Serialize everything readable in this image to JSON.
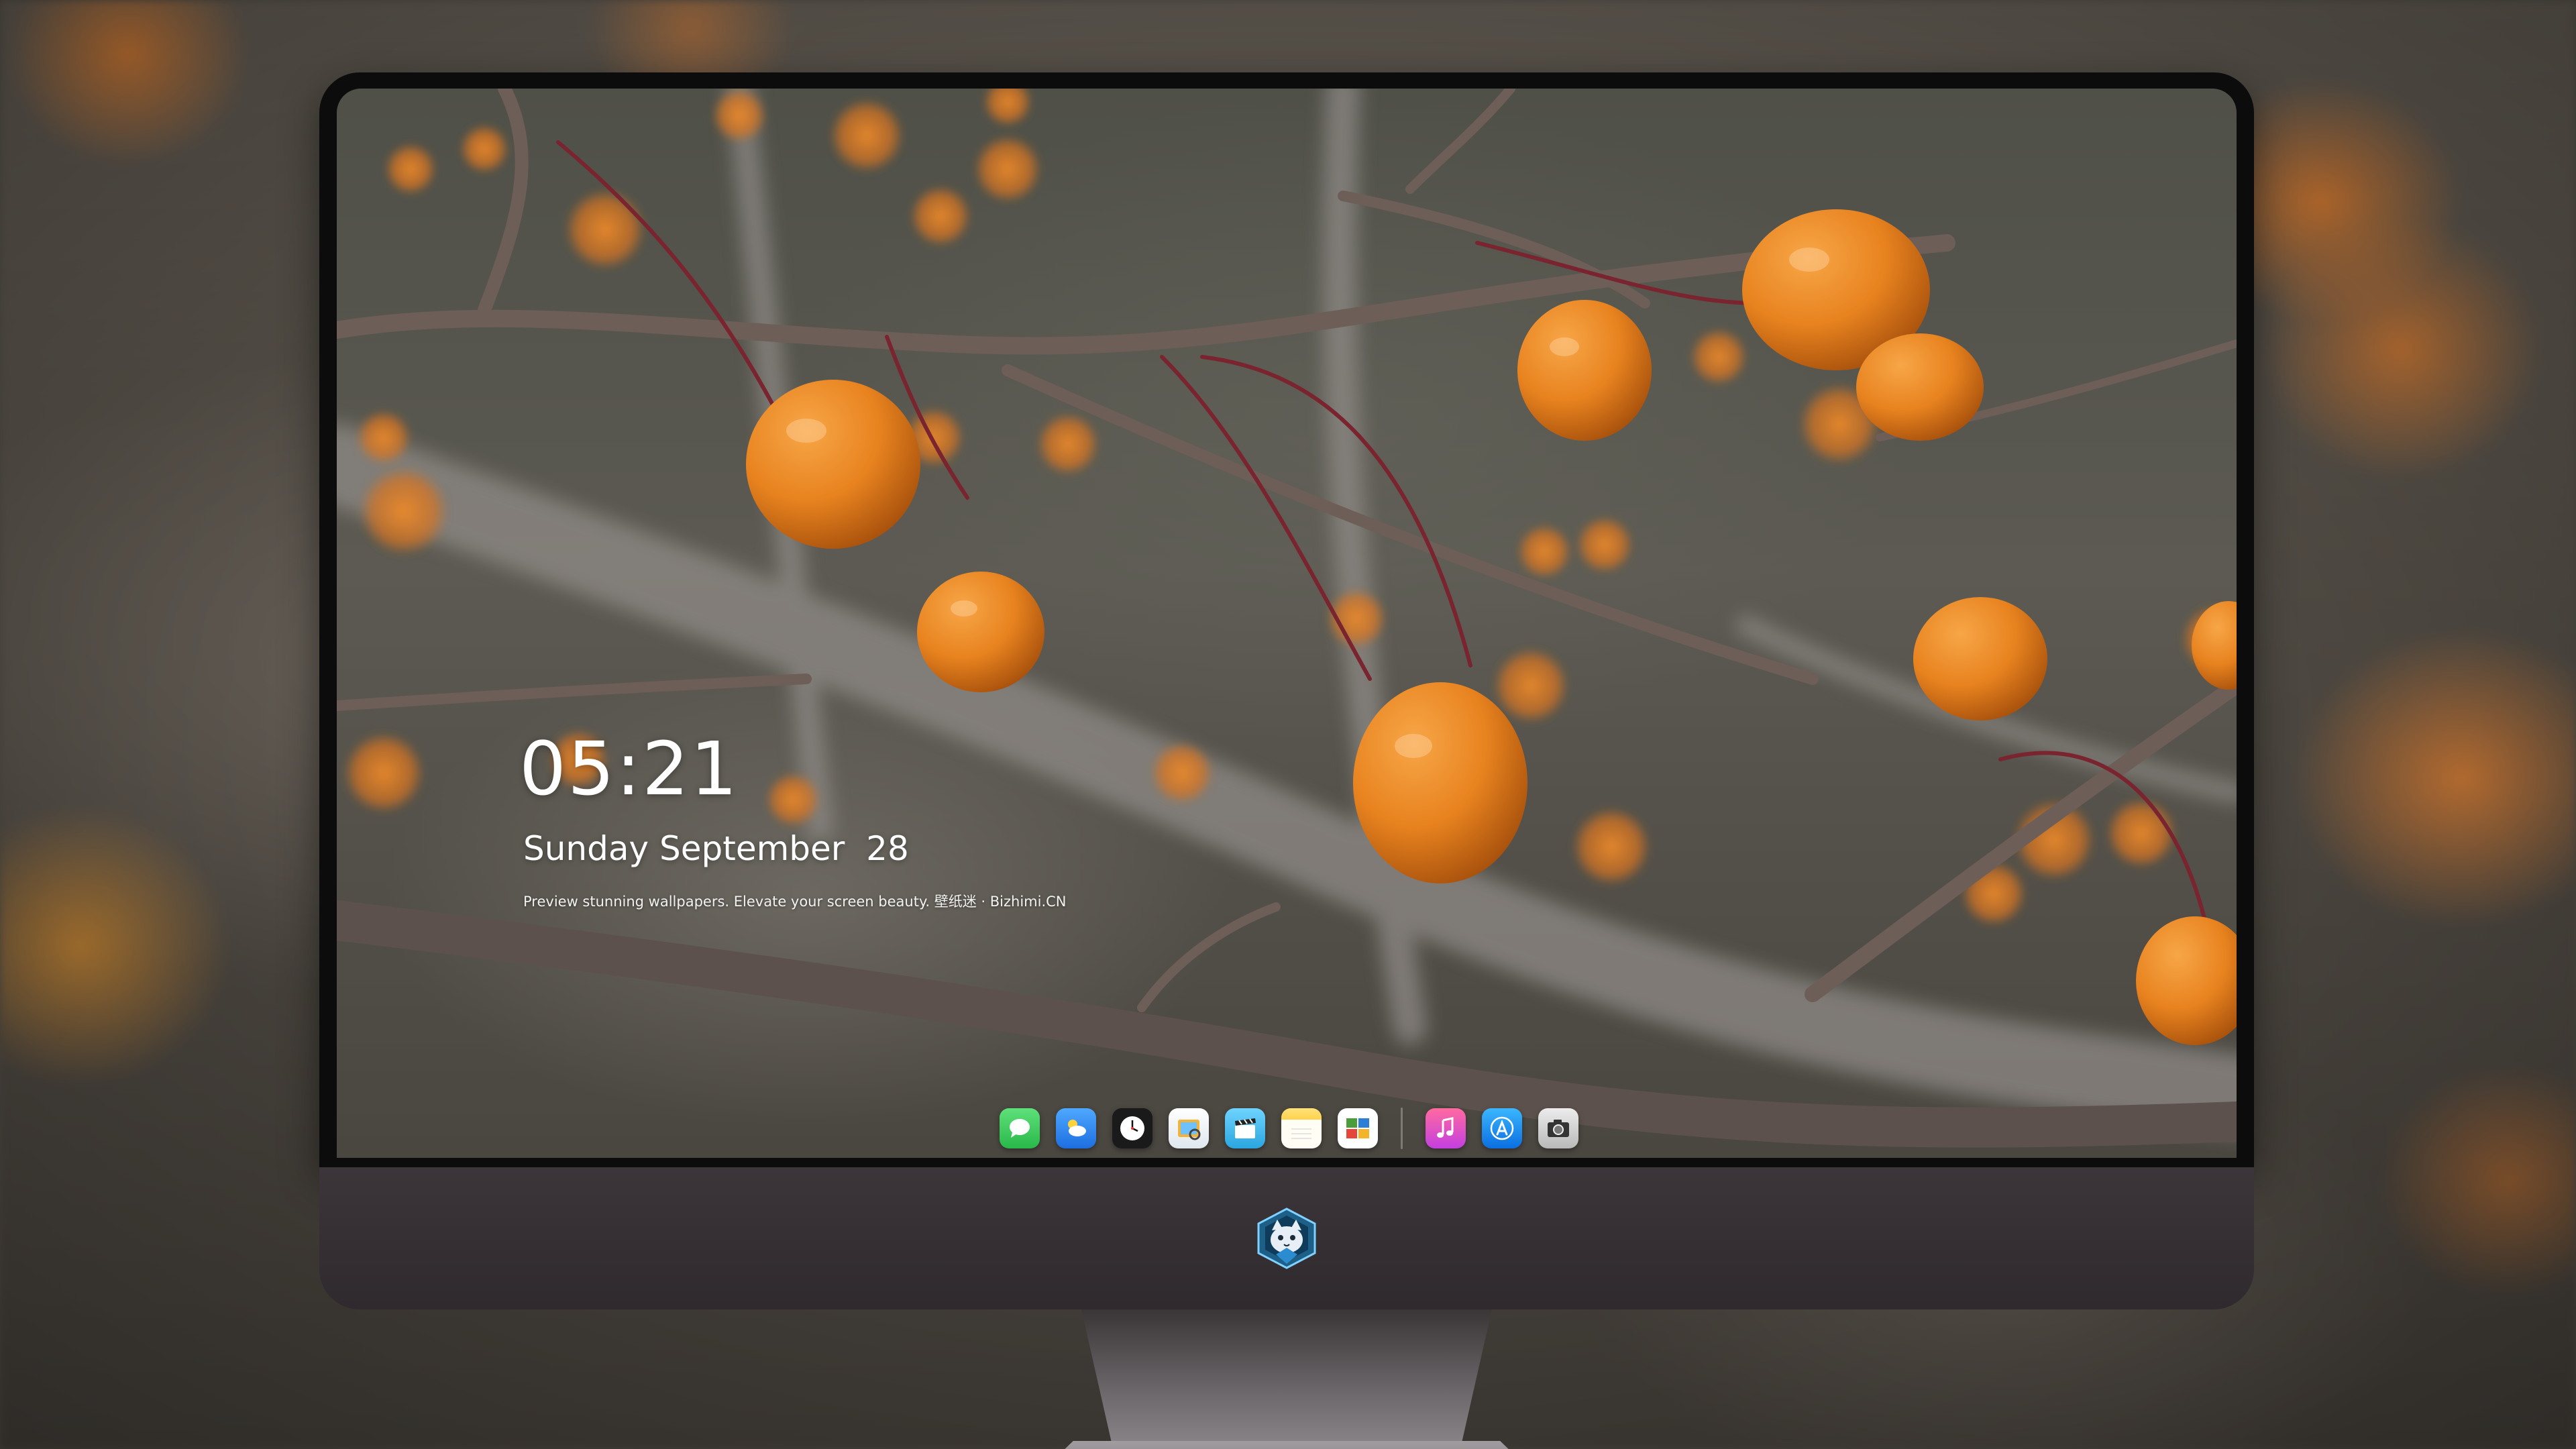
{
  "lock_screen": {
    "time": "05:21",
    "date": "Sunday September  28",
    "caption": "Preview stunning wallpapers. Elevate your screen beauty. 壁纸迷 · Bizhimi.CN"
  },
  "dock": {
    "apps": [
      {
        "name": "messages",
        "icon": "messages-icon",
        "color": "#34c759"
      },
      {
        "name": "weather",
        "icon": "weather-icon",
        "color": "#2e8ef0"
      },
      {
        "name": "clock",
        "icon": "clock-icon",
        "color": "#ffffff"
      },
      {
        "name": "preview",
        "icon": "preview-icon",
        "color": "#f2b33a"
      },
      {
        "name": "clips",
        "icon": "clips-icon",
        "color": "#3fb6e6"
      },
      {
        "name": "notes",
        "icon": "notes-icon",
        "color": "#ffd24d"
      },
      {
        "name": "photo-booth",
        "icon": "photo-booth-icon",
        "color": "#4a9d3a"
      },
      {
        "name": "music",
        "icon": "music-icon",
        "color": "#f0497a"
      },
      {
        "name": "app-store",
        "icon": "app-store-icon",
        "color": "#1a8cff"
      },
      {
        "name": "camera",
        "icon": "camera-icon",
        "color": "#d0d0d0"
      }
    ]
  },
  "colors": {
    "berry": "#e8831f",
    "bezel": "#0c0c0d",
    "chin": "#35303a"
  },
  "monitor": {
    "logo": "cat-mascot-logo"
  }
}
